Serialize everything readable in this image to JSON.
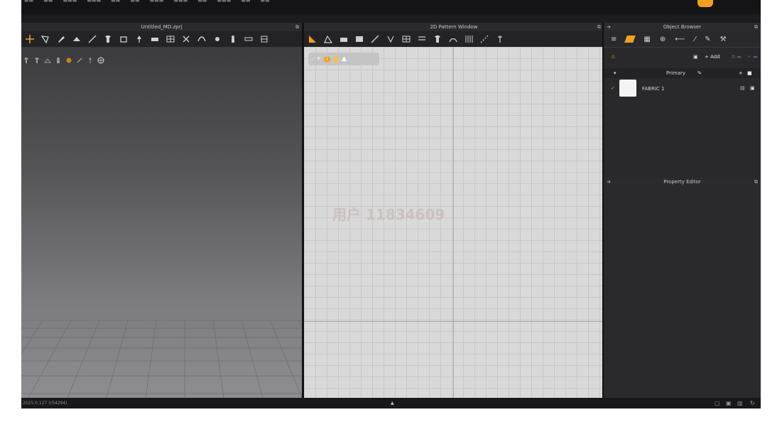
{
  "window": {
    "file_title": "Untitled_MD.zprj",
    "pattern_title": "2D Pattern Window",
    "object_browser_title": "Object Browser",
    "property_editor_title": "Property Editor"
  },
  "object_browser": {
    "add_label": "+ Add",
    "primary_label": "Primary",
    "fabrics": [
      {
        "name": "FABRIC 1",
        "color": "#f4f4f4"
      }
    ]
  },
  "status": {
    "version": "2025.0.127 (r54294)",
    "indicator": "▲"
  },
  "watermark": "用户 11834609",
  "colors": {
    "accent": "#f0a020",
    "panel": "#29292c",
    "pattern_bg": "#d9d9d9"
  },
  "icons": {
    "tab_list": "list-icon",
    "tab_fabric": "fabric-icon",
    "tab_pattern": "pattern-icon",
    "tab_button": "button-icon",
    "tab_topstitch": "topstitch-icon",
    "tab_needle": "needle-icon",
    "tab_pin": "pin-icon",
    "tab_hanger": "hanger-icon"
  }
}
